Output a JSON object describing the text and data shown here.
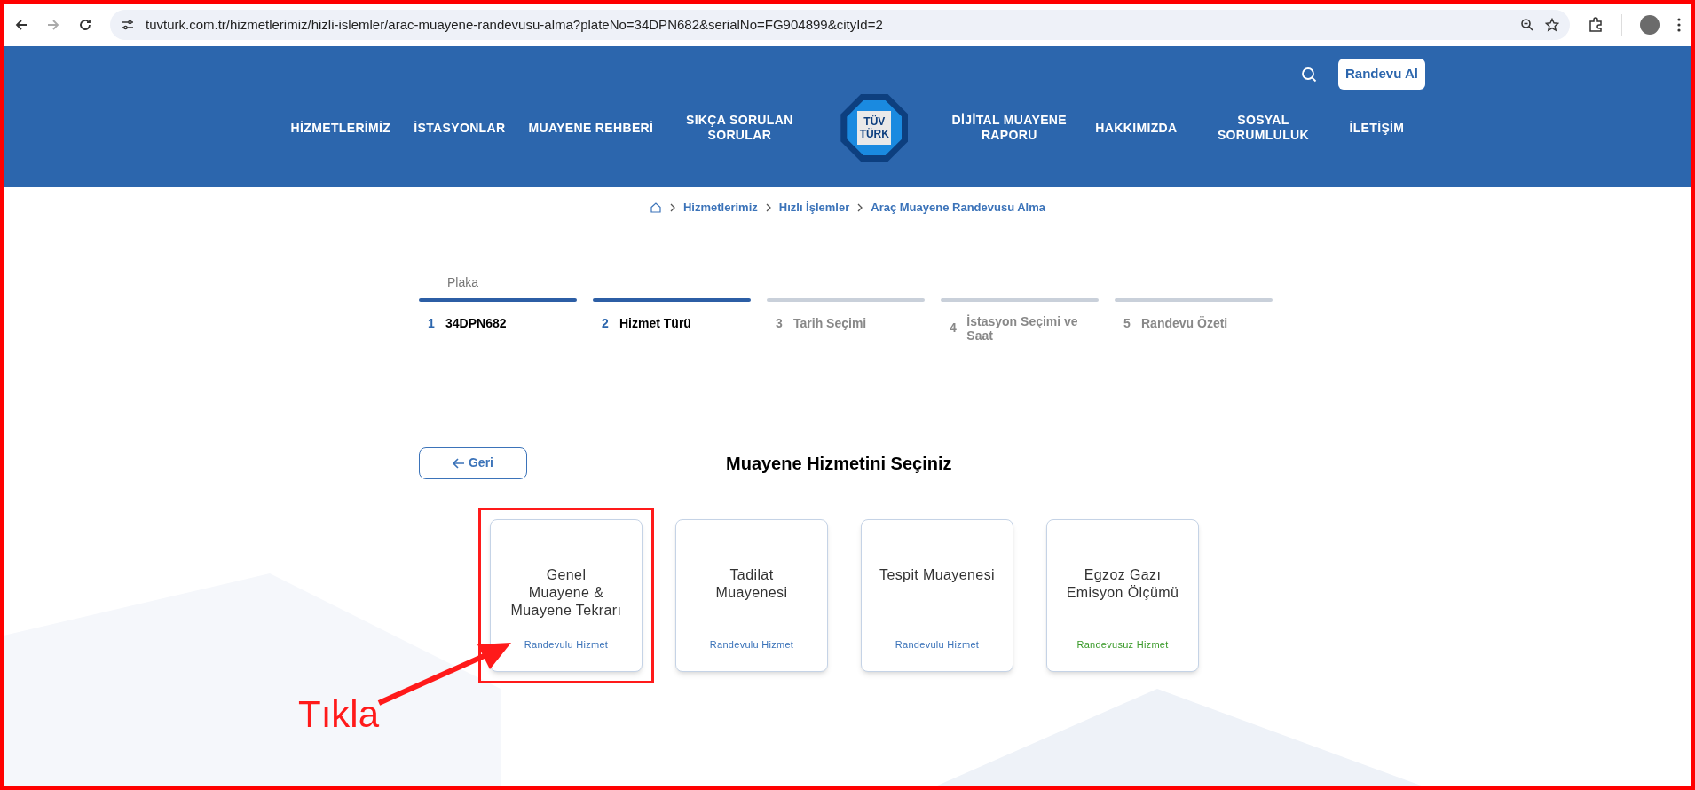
{
  "browser": {
    "url": "tuvturk.com.tr/hizmetlerimiz/hizli-islemler/arac-muayene-randevusu-alma?plateNo=34DPN682&serialNo=FG904899&cityId=2"
  },
  "header": {
    "cta": "Randevu Al",
    "nav_left": [
      "HİZMETLERİMİZ",
      "İSTASYONLAR",
      "MUAYENE REHBERİ",
      "SIKÇA SORULAN SORULAR"
    ],
    "logo": [
      "TÜV",
      "TÜRK"
    ],
    "nav_right": [
      "DİJİTAL MUAYENE RAPORU",
      "HAKKIMIZDA",
      "SOSYAL SORUMLULUK",
      "İLETİŞİM"
    ]
  },
  "breadcrumb": [
    "Hizmetlerimiz",
    "Hızlı İşlemler",
    "Araç Muayene Randevusu Alma"
  ],
  "steps": [
    {
      "caption": "Plaka",
      "number": "1",
      "label": "34DPN682",
      "active": true
    },
    {
      "number": "2",
      "label": "Hizmet Türü",
      "active": true
    },
    {
      "number": "3",
      "label": "Tarih Seçimi",
      "active": false
    },
    {
      "number": "4",
      "label": "İstasyon Seçimi ve Saat",
      "active": false
    },
    {
      "number": "5",
      "label": "Randevu Özeti",
      "active": false
    }
  ],
  "back_button": "Geri",
  "title": "Muayene Hizmetini Seçiniz",
  "cards": [
    {
      "title": "Genel Muayene & Muayene Tekrarı",
      "subtitle": "Randevulu Hizmet",
      "color": "#3b73b9",
      "highlighted": true
    },
    {
      "title": "Tadilat Muayenesi",
      "subtitle": "Randevulu Hizmet",
      "color": "#3b73b9",
      "highlighted": false
    },
    {
      "title": "Tespit Muayenesi",
      "subtitle": "Randevulu Hizmet",
      "color": "#3b73b9",
      "highlighted": false
    },
    {
      "title": "Egzoz Gazı Emisyon Ölçümü",
      "subtitle": "Randevusuz Hizmet",
      "color": "#3a9a2a",
      "highlighted": false
    }
  ],
  "annotation": {
    "text": "Tıkla"
  }
}
